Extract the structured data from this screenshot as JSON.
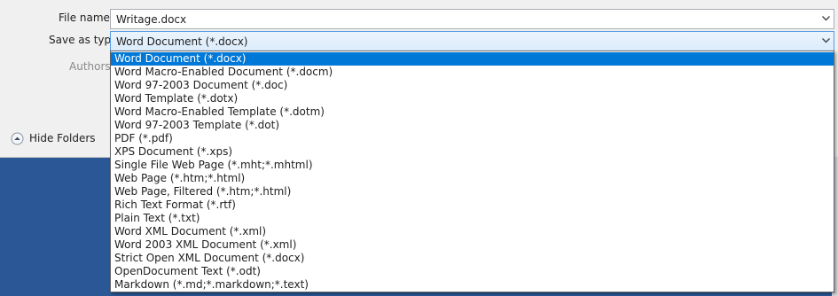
{
  "form": {
    "file_name_label": "File name:",
    "file_name_value": "Writage.docx",
    "save_type_label": "Save as type:",
    "save_type_value": "Word Document (*.docx)",
    "authors_label": "Authors:"
  },
  "hide_folders": {
    "label": "Hide Folders",
    "icon": "chevron-up-circle-icon"
  },
  "dropdown": {
    "selected_index": 0,
    "options": [
      "Word Document (*.docx)",
      "Word Macro-Enabled Document (*.docm)",
      "Word 97-2003 Document (*.doc)",
      "Word Template (*.dotx)",
      "Word Macro-Enabled Template (*.dotm)",
      "Word 97-2003 Template (*.dot)",
      "PDF (*.pdf)",
      "XPS Document (*.xps)",
      "Single File Web Page (*.mht;*.mhtml)",
      "Web Page (*.htm;*.html)",
      "Web Page, Filtered (*.htm;*.html)",
      "Rich Text Format (*.rtf)",
      "Plain Text (*.txt)",
      "Word XML Document (*.xml)",
      "Word 2003 XML Document (*.xml)",
      "Strict Open XML Document (*.docx)",
      "OpenDocument Text (*.odt)",
      "Markdown (*.md;*.markdown;*.text)"
    ]
  },
  "colors": {
    "desktop_background": "#2b5797",
    "dialog_background": "#f0f0f0",
    "selection": "#0078d7",
    "focus_border": "#569de5"
  }
}
